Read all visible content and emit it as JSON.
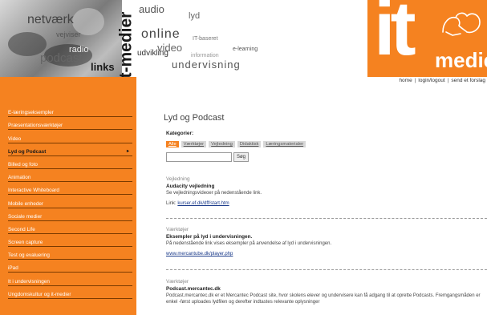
{
  "banner": {
    "vertical_title": "it-medier",
    "photo_words": [
      "netværk",
      "podcast",
      "radio",
      "links",
      "vejviser"
    ],
    "cloud_words": [
      "audio",
      "lyd",
      "online",
      "video",
      "udvikling",
      "undervisning",
      "e-learning",
      "information",
      "IT-baseret"
    ],
    "logo_it": "it",
    "logo_medier": "medie",
    "orange": "#f58220"
  },
  "top_links": [
    "home",
    "login/logout",
    "send et forslag"
  ],
  "sidebar": {
    "items": [
      {
        "label": "E-læringseksempler",
        "active": false
      },
      {
        "label": "Præsentationsværktøjer",
        "active": false
      },
      {
        "label": "Video",
        "active": false
      },
      {
        "label": "Lyd og Podcast",
        "active": true
      },
      {
        "label": "Billed og foto",
        "active": false
      },
      {
        "label": "Animation",
        "active": false
      },
      {
        "label": "Interactive Whiteboard",
        "active": false
      },
      {
        "label": "Mobile enheder",
        "active": false
      },
      {
        "label": "Sociale medier",
        "active": false
      },
      {
        "label": "Second Life",
        "active": false
      },
      {
        "label": "Screen capture",
        "active": false
      },
      {
        "label": "Test og evaluering",
        "active": false
      },
      {
        "label": "iPad",
        "active": false
      },
      {
        "label": "It i undervisningen",
        "active": false
      },
      {
        "label": "Ungdomskultur og it-medier",
        "active": false
      }
    ],
    "active_arrow": "▸"
  },
  "main": {
    "title": "Lyd og Podcast",
    "categories_label": "Kategorier:",
    "tabs": [
      {
        "label": "Alle",
        "active": true
      },
      {
        "label": "Værktøjer",
        "active": false
      },
      {
        "label": "Vejledning",
        "active": false
      },
      {
        "label": "Didaktisk",
        "active": false
      },
      {
        "label": "Læringsmaterialer",
        "active": false
      }
    ],
    "search_value": "",
    "search_button": "Søg",
    "entries": [
      {
        "category": "Vejledning",
        "title": "Audacity vejledning",
        "description": "Se vejledningsvideoer på nedenstående link.",
        "link_prefix": "Link: ",
        "link_text": "kurser.ef.dk/dff/start.htm"
      },
      {
        "category": "Værktøjer",
        "title": "Eksempler på lyd i undervisningen.",
        "description": "På nedenstående link vises eksempler på anvendelse af lyd i undervisningen.",
        "link_prefix": "",
        "link_text": "www.mercantube.dk/player.php"
      },
      {
        "category": "Værktøjer",
        "title": "Podcast.mercantec.dk",
        "description": "Podcast.mercantec.dk er et Mercantec Podcast site, hvor skolens elever og undervisere kan få adgang til at oprette Podcasts. Fremgangsmåden er enkel -først uploades lydfilen og derefter indtastes relevante oplysninger",
        "link_prefix": "",
        "link_text": ""
      }
    ]
  }
}
